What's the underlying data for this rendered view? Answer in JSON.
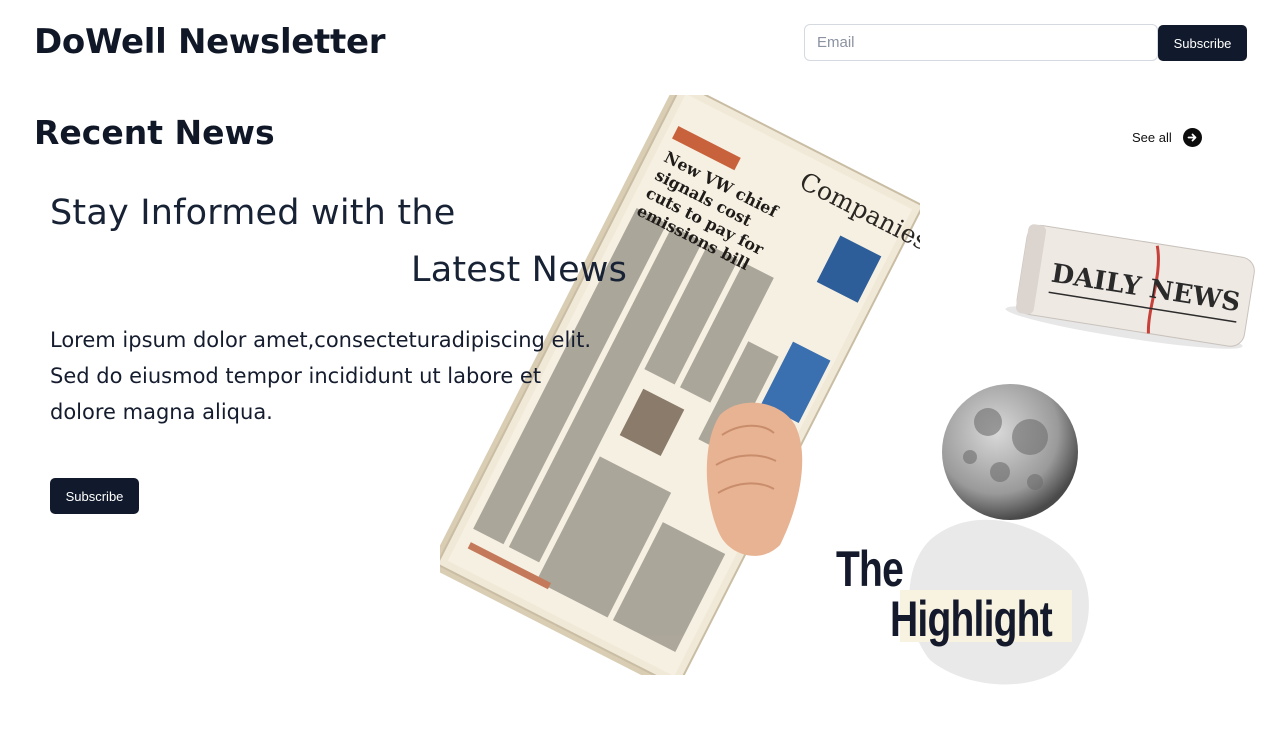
{
  "header": {
    "brand": "DoWell Newsletter",
    "email_placeholder": "Email",
    "subscribe_label": "Subscribe"
  },
  "section": {
    "title": "Recent News",
    "see_all_label": "See all"
  },
  "hero": {
    "headline_line1": "Stay Informed with the",
    "headline_line2": "Latest News",
    "body": "Lorem ipsum dolor amet,consecteturadipiscing elit. Sed do eiusmod tempor incididunt ut labore et dolore magna aliqua.",
    "subscribe_label": "Subscribe"
  },
  "art": {
    "newspaper_masthead": "Companies",
    "newspaper_headline": "New VW chief signals cost cuts to pay for emissions bill",
    "rolled_paper_title": "DAILY NEWS",
    "highlight_line1": "The",
    "highlight_line2": "Highlight"
  },
  "icons": {
    "see_all": "arrow-right-circle-icon",
    "moon": "moon-icon"
  },
  "colors": {
    "primary": "#111a2c",
    "text": "#141c2e",
    "background": "#ffffff"
  }
}
